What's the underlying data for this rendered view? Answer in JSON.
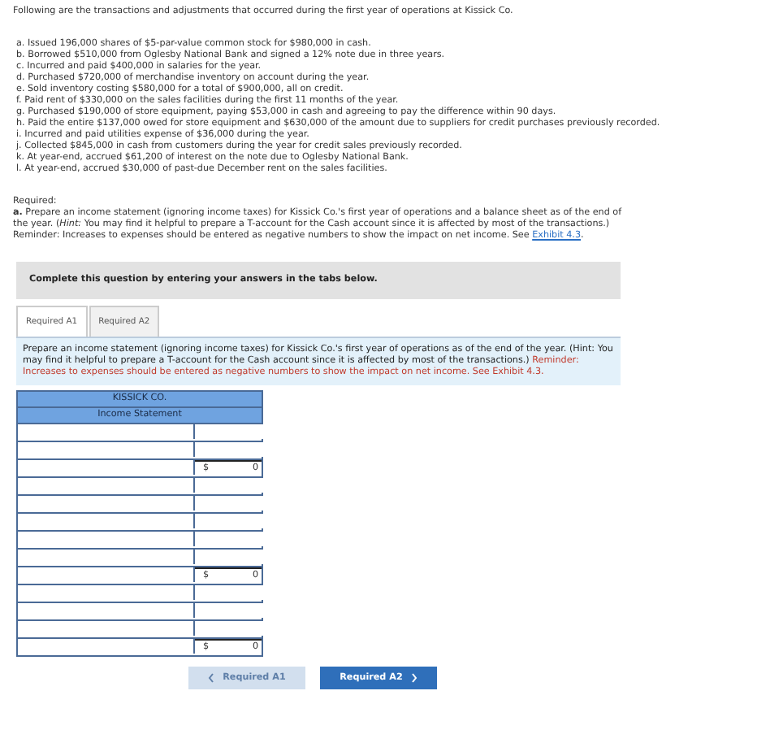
{
  "intro": "Following are the transactions and adjustments that occurred during the first year of operations at Kissick Co.",
  "transactions": [
    "a. Issued 196,000 shares of $5-par-value common stock for $980,000 in cash.",
    "b. Borrowed $510,000 from Oglesby National Bank and signed a 12% note due in three years.",
    "c. Incurred and paid $400,000 in salaries for the year.",
    "d. Purchased $720,000 of merchandise inventory on account during the year.",
    "e. Sold inventory costing $580,000 for a total of $900,000, all on credit.",
    "f. Paid rent of $330,000 on the sales facilities during the first 11 months of the year.",
    "g. Purchased $190,000 of store equipment, paying $53,000 in cash and agreeing to pay the difference within 90 days.",
    "h. Paid the entire $137,000 owed for store equipment and $630,000 of the amount due to suppliers for credit purchases previously recorded.",
    "i. Incurred and paid utilities expense of $36,000 during the year.",
    "j. Collected $845,000 in cash from customers during the year for credit sales previously recorded.",
    "k. At year-end, accrued $61,200 of interest on the note due to Oglesby National Bank.",
    "l. At year-end, accrued $30,000 of past-due December rent on the sales facilities."
  ],
  "required": {
    "heading": "Required:",
    "text": "**a.** Prepare an income statement (ignoring income taxes) for Kissick Co.'s first year of operations and a balance sheet as of the end of the year. (*Hint:* You may find it helpful to prepare a T-account for the Cash account since it is affected by most of the transactions.) Reminder: Increases to expenses should be entered as negative numbers to show the impact on net income. See",
    "link": "Exhibit 4.3",
    "end": "."
  },
  "banner": "Complete this question by entering your answers in the tabs below.",
  "tabs": [
    {
      "label": "Required A1",
      "selected": true
    },
    {
      "label": "Required A2",
      "selected": false
    }
  ],
  "instruction": {
    "text": "Prepare an income statement (ignoring income taxes) for Kissick Co.'s first year of operations as of the end of the year. (Hint: You may find it helpful to prepare a T-account for the Cash account since it is affected by most of the transactions.)",
    "reminder": "Reminder: Increases to expenses should be entered as negative numbers to show the impact on net income. See Exhibit 4.3."
  },
  "statement": {
    "company": "KISSICK CO.",
    "title": "Income Statement",
    "rows": [
      {
        "kind": "input"
      },
      {
        "kind": "input"
      },
      {
        "kind": "total",
        "currency": "$",
        "amount": "0"
      },
      {
        "kind": "input"
      },
      {
        "kind": "input"
      },
      {
        "kind": "input"
      },
      {
        "kind": "input"
      },
      {
        "kind": "input"
      },
      {
        "kind": "total",
        "currency": "$",
        "amount": "0"
      },
      {
        "kind": "input"
      },
      {
        "kind": "input"
      },
      {
        "kind": "input"
      },
      {
        "kind": "total",
        "currency": "$",
        "amount": "0"
      }
    ]
  },
  "nav": [
    {
      "label": "Required A1",
      "kind": "prev",
      "disabled": true
    },
    {
      "label": "Required A2",
      "kind": "next",
      "disabled": false
    }
  ]
}
